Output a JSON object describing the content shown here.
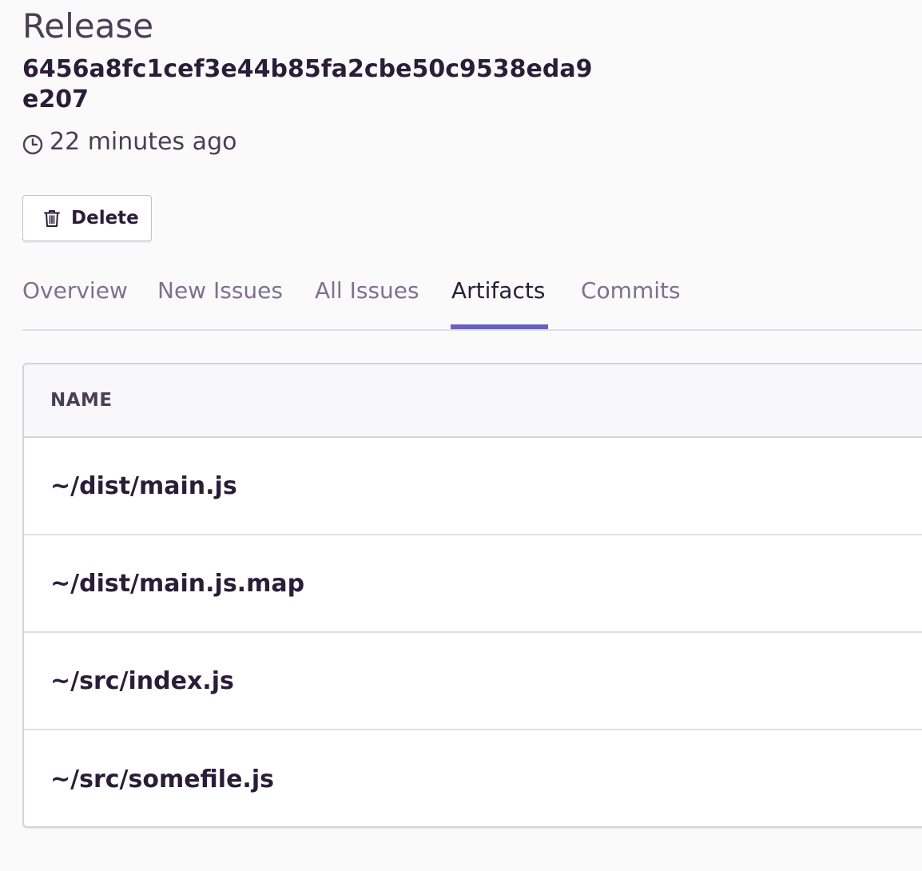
{
  "header": {
    "label": "Release",
    "version": "6456a8fc1cef3e44b85fa2cbe50c9538eda9e207",
    "timestamp": "22 minutes ago"
  },
  "actions": {
    "delete_label": "Delete"
  },
  "tabs": [
    {
      "label": "Overview",
      "active": false
    },
    {
      "label": "New Issues",
      "active": false
    },
    {
      "label": "All Issues",
      "active": false
    },
    {
      "label": "Artifacts",
      "active": true
    },
    {
      "label": "Commits",
      "active": false
    }
  ],
  "artifacts": {
    "column_header": "NAME",
    "rows": [
      {
        "name": "~/dist/main.js"
      },
      {
        "name": "~/dist/main.js.map"
      },
      {
        "name": "~/src/index.js"
      },
      {
        "name": "~/src/somefile.js"
      }
    ]
  },
  "colors": {
    "accent": "#6c5fc7",
    "text_primary": "#2b1d38",
    "text_muted": "#80708f",
    "border": "#d6d0de"
  }
}
